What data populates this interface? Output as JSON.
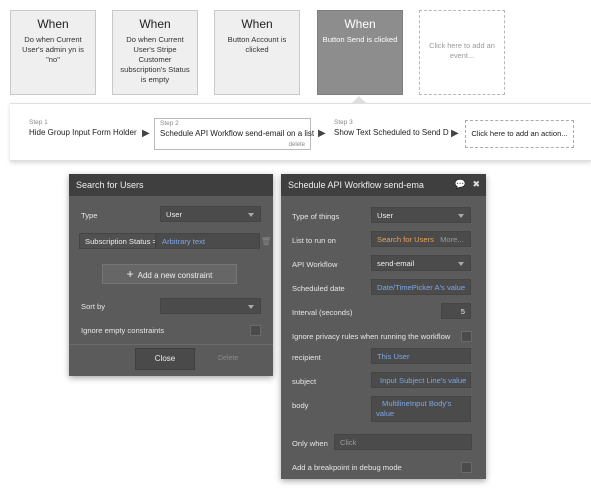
{
  "events": [
    {
      "when": "When",
      "desc": "Do when Current User's admin yn is \"no\""
    },
    {
      "when": "When",
      "desc": "Do when Current User's Stripe Customer subscription's Status is empty"
    },
    {
      "when": "When",
      "desc": "Button Account is clicked"
    },
    {
      "when": "When",
      "desc": "Button Send is clicked"
    },
    {
      "when": "",
      "desc": "Click here to add an event..."
    }
  ],
  "steps": [
    {
      "num": "Step 1",
      "label": "Hide Group Input Form Holder"
    },
    {
      "num": "Step 2",
      "label": "Schedule API Workflow send-email on a list",
      "delete": "delete"
    },
    {
      "num": "Step 3",
      "label": "Show Text Scheduled to Send D"
    }
  ],
  "add_action": "Click here to add an action...",
  "search_panel": {
    "title": "Search for Users",
    "type_label": "Type",
    "type_value": "User",
    "constraint_label": "Subscription Status =",
    "constraint_value": "Arbitrary text",
    "add_constraint": "Add a new constraint",
    "sort_label": "Sort by",
    "ignore_label": "Ignore empty constraints",
    "close": "Close",
    "delete": "Delete"
  },
  "schedule_panel": {
    "title": "Schedule API Workflow send-ema",
    "type_label": "Type of things",
    "type_value": "User",
    "list_label": "List to run on",
    "list_value": "Search for Users",
    "list_more": "More...",
    "api_label": "API Workflow",
    "api_value": "send-email",
    "date_label": "Scheduled date",
    "date_value": "Date/TimePicker A's value",
    "interval_label": "Interval (seconds)",
    "interval_value": "5",
    "privacy_label": "Ignore privacy rules when running the workflow",
    "recipient_label": "recipient",
    "recipient_value": "This User",
    "subject_label": "subject",
    "subject_value": "Input Subject Line's value",
    "body_label": "body",
    "body_value_1": "MultilineInput Body's",
    "body_value_2": "value",
    "only_when_label": "Only when",
    "only_when_placeholder": "Click",
    "breakpoint_label": "Add a breakpoint in debug mode"
  }
}
